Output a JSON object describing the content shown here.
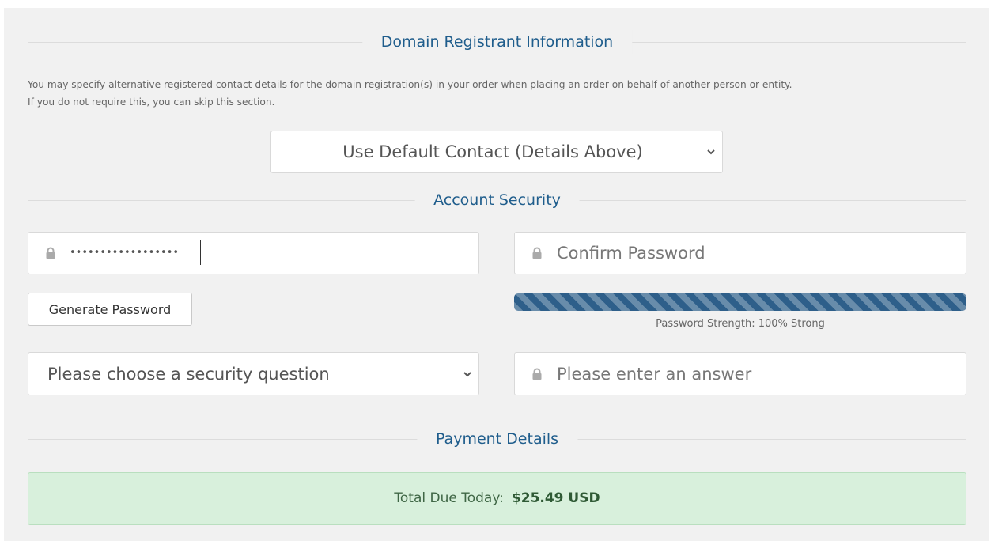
{
  "registrant": {
    "title": "Domain Registrant Information",
    "description_line1": "You may specify alternative registered contact details for the domain registration(s) in your order when placing an order on behalf of another person or entity.",
    "description_line2": "If you do not require this, you can skip this section.",
    "contact_select_value": "Use Default Contact (Details Above)"
  },
  "security": {
    "title": "Account Security",
    "password_masked": "••••••••••••••••••",
    "confirm_placeholder": "Confirm Password",
    "generate_label": "Generate Password",
    "strength_text": "Password Strength: 100% Strong",
    "strength_percent": 100,
    "strength_color": "#2e5f8a",
    "question_select_value": "Please choose a security question",
    "answer_placeholder": "Please enter an answer"
  },
  "payment": {
    "title": "Payment Details",
    "total_label": "Total Due Today:",
    "total_amount": "$25.49 USD"
  },
  "colors": {
    "heading": "#1f5d8c",
    "panel_bg": "#f1f1f1",
    "success_bg": "#d8f0dc"
  },
  "icons": {
    "field_icon": "lock-icon",
    "select_icon": "chevron-down-icon"
  }
}
